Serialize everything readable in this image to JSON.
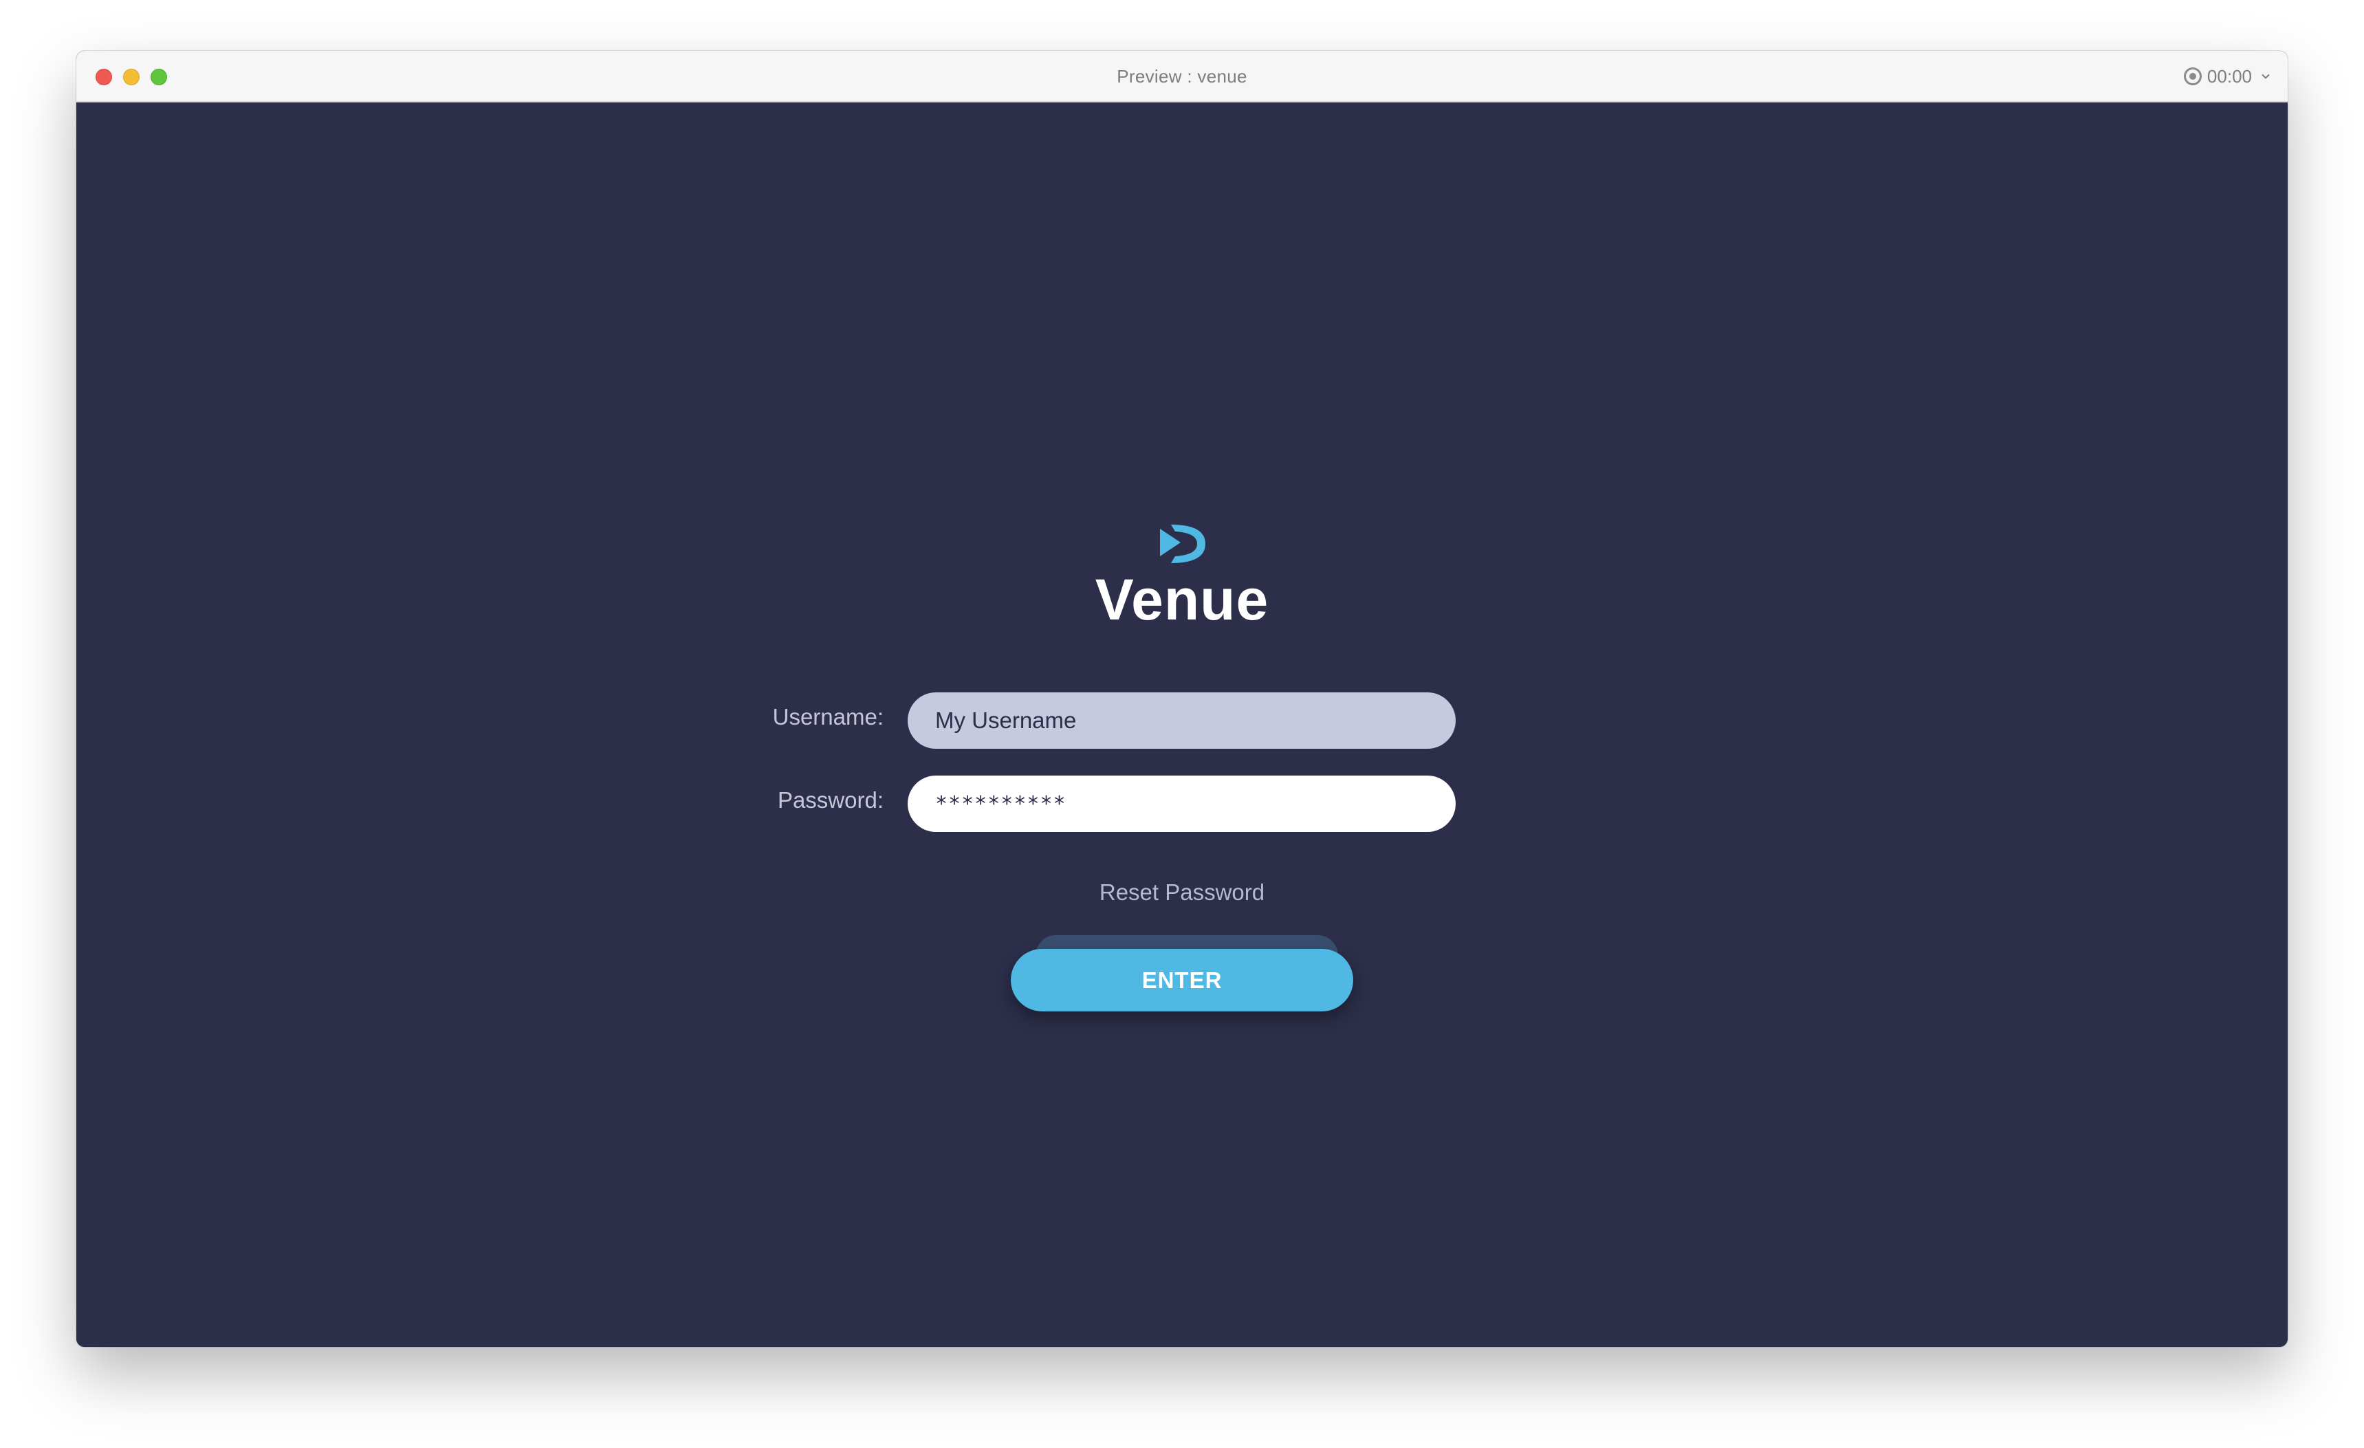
{
  "window": {
    "title": "Preview : venue",
    "recorder_time": "00:00"
  },
  "login": {
    "brand": "Venue",
    "username_label": "Username:",
    "username_value": "My Username",
    "password_label": "Password:",
    "password_value": "**********",
    "reset_label": "Reset Password",
    "enter_label": "ENTER"
  },
  "icons": {
    "logo": "venue-play-logo-icon",
    "record": "record-icon",
    "chevron": "chevron-down-icon"
  },
  "colors": {
    "background": "#2c2e4a",
    "accent": "#4fb9e4",
    "username_field": "#c7c9df",
    "password_field": "#ffffff"
  }
}
